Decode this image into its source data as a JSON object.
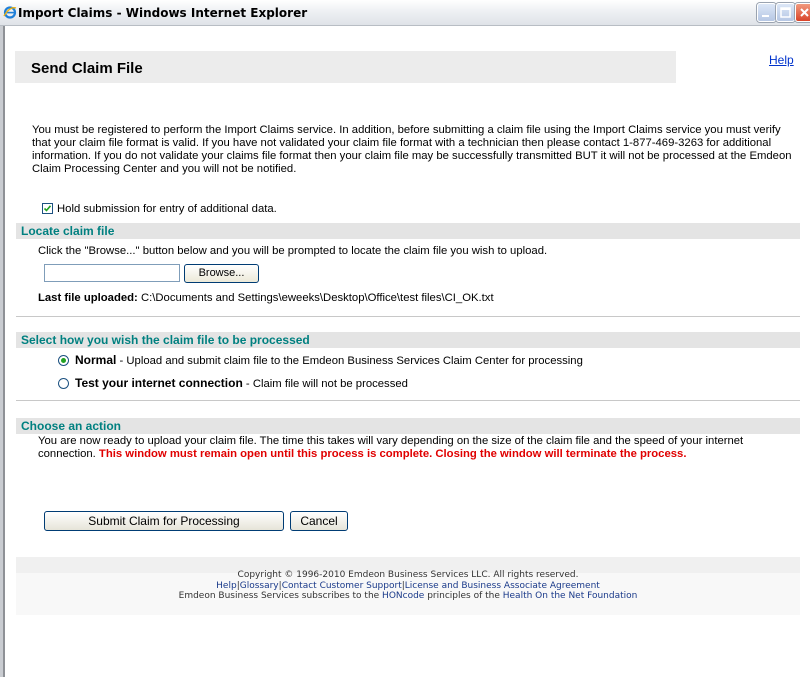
{
  "window": {
    "title": "Import Claims - Windows Internet Explorer"
  },
  "header": {
    "title": "Send Claim File",
    "help_link": "Help"
  },
  "intro_text": "You must be registered to perform the Import Claims service. In addition, before submitting a claim file using the Import Claims service you must verify that your claim file format is valid. If you have not validated your claim file format with a technician then please contact 1-877-469-3263 for additional information. If you do not validate your claims file format then your claim file may be successfully transmitted BUT it will not be processed at the Emdeon Claim Processing Center and you will not be notified.",
  "hold_checkbox": {
    "label": "Hold submission for entry of additional data.",
    "checked": true
  },
  "locate_section": {
    "heading": "Locate claim file",
    "instruction": "Click the \"Browse...\" button below and you will be prompted to locate the claim file you wish to upload.",
    "file_input_value": "",
    "browse_label": "Browse...",
    "last_uploaded_label": "Last file uploaded:",
    "last_uploaded_path": "C:\\Documents and Settings\\eweeks\\Desktop\\Office\\test files\\CI_OK.txt"
  },
  "process_section": {
    "heading": "Select how you wish the claim file to be processed",
    "options": [
      {
        "label": "Normal",
        "description": " - Upload and submit claim file to the Emdeon Business Services Claim Center for processing",
        "selected": true
      },
      {
        "label": "Test your internet connection",
        "description": " - Claim file will not be processed",
        "selected": false
      }
    ]
  },
  "action_section": {
    "heading": "Choose an action",
    "text": "You are now ready to upload your claim file. The time this takes will vary depending on the size of the claim file and the speed of your internet connection. ",
    "warning": "This window must remain open until this process is complete. Closing the window will terminate the process.",
    "submit_label": "Submit Claim for Processing",
    "cancel_label": "Cancel"
  },
  "footer": {
    "copyright": "Copyright © 1996-2010 Emdeon Business Services LLC. All rights reserved.",
    "links": [
      "Help",
      "Glossary",
      "Contact Customer Support",
      "License and Business Associate Agreement"
    ],
    "separator": "|",
    "hon_prefix": "Emdeon Business Services subscribes to the ",
    "hon_link": "HONcode",
    "hon_middle": " principles of the ",
    "hon_foundation": "Health On the Net Foundation"
  },
  "colors": {
    "section_heading": "#008080",
    "warning": "#e00000",
    "link": "#0033cc"
  }
}
